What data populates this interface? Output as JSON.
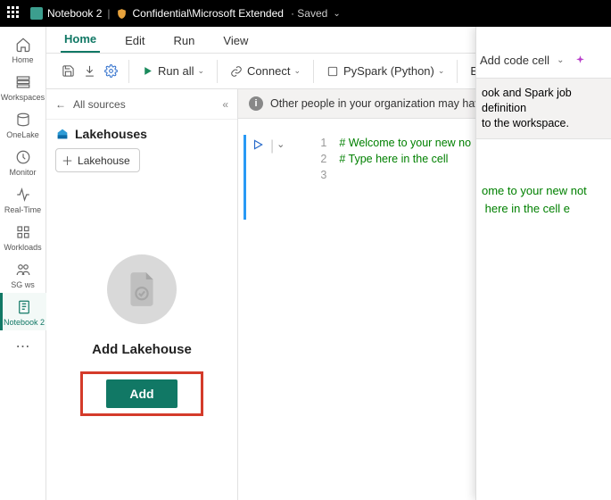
{
  "topbar": {
    "notebook_name": "Notebook 2",
    "sensitivity": "Confidential\\Microsoft Extended",
    "saved_label": "Saved"
  },
  "leftrail": {
    "items": [
      {
        "id": "home",
        "label": "Home"
      },
      {
        "id": "workspaces",
        "label": "Workspaces"
      },
      {
        "id": "onelake",
        "label": "OneLake"
      },
      {
        "id": "monitor",
        "label": "Monitor"
      },
      {
        "id": "realtime",
        "label": "Real-Time"
      },
      {
        "id": "workloads",
        "label": "Workloads"
      },
      {
        "id": "sgws",
        "label": "SG ws"
      },
      {
        "id": "notebook2",
        "label": "Notebook 2"
      }
    ]
  },
  "tabs": {
    "items": [
      "Home",
      "Edit",
      "Run",
      "View"
    ],
    "active": "Home"
  },
  "toolbar": {
    "run_all": "Run all",
    "connect": "Connect",
    "language": "PySpark (Python)",
    "environment": "Environm"
  },
  "explorer": {
    "all_sources": "All sources",
    "section_title": "Lakehouses",
    "chip_label": "Lakehouse",
    "empty_title": "Add Lakehouse",
    "add_button": "Add"
  },
  "editor": {
    "banner": "Other people in your organization may have access",
    "code_lines": [
      "# Welcome to your new no",
      "# Type here in the cell ",
      ""
    ]
  },
  "overlay": {
    "add_code_cell": "Add code cell",
    "banner_line1": "ook and Spark job definition",
    "banner_line2": "to the workspace.",
    "code_line1": "ome to your new not",
    "code_line2": " here in the cell e"
  }
}
